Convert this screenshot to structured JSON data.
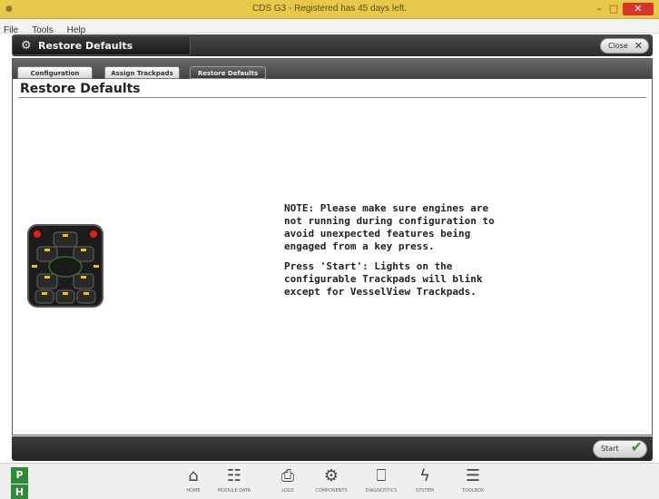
{
  "window": {
    "title": "CDS G3 - Registered has 45 days left.",
    "controls": {
      "minimize": "–",
      "maximize": "□",
      "close": "✕"
    }
  },
  "menu": [
    "File",
    "Tools",
    "Help"
  ],
  "header": {
    "panel_title": "Restore Defaults",
    "close_label": "Close",
    "close_glyph": "✕"
  },
  "tabs": [
    {
      "label": "Configuration",
      "active": false
    },
    {
      "label": "Assign Trackpads",
      "active": false
    },
    {
      "label": "Restore Defaults",
      "active": true
    }
  ],
  "page": {
    "title": "Restore Defaults",
    "note": "NOTE: Please make sure engines are not running during configuration to avoid unexpected features being engaged from a key press.",
    "instruction": "Press 'Start': Lights on the configurable Trackpads will blink except for VesselView Trackpads."
  },
  "footer": {
    "start_label": "Start",
    "start_glyph": "✔"
  },
  "side_indicators": [
    "P",
    "H"
  ],
  "nav": [
    {
      "label": "HOME",
      "icon": "home-icon",
      "glyph": "⌂"
    },
    {
      "label": "MODULE DATA",
      "icon": "module-data-icon",
      "glyph": "☷"
    },
    {
      "label": "LOGS",
      "icon": "logs-icon",
      "glyph": "⎙"
    },
    {
      "label": "COMPONENTS",
      "icon": "components-icon",
      "glyph": "⚙"
    },
    {
      "label": "DIAGNOSTICS",
      "icon": "diagnostics-icon",
      "glyph": "⎕"
    },
    {
      "label": "SYSTEM",
      "icon": "system-icon",
      "glyph": "ϟ"
    },
    {
      "label": "TOOLBOX",
      "icon": "toolbox-icon",
      "glyph": "☰"
    }
  ],
  "colors": {
    "titlebar": "#e8c84a",
    "close_button": "#d6342c",
    "indicator_green": "#2f8a3a",
    "start_check": "#3a9a2a",
    "trackpad_led_red": "#e02020",
    "trackpad_led_yellow": "#f2c400"
  }
}
